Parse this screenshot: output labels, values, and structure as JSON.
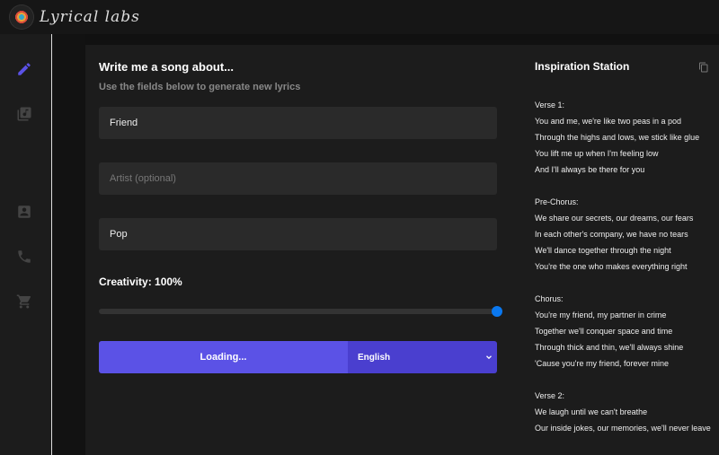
{
  "app": {
    "name": "Lyrical labs"
  },
  "sidebar": {
    "items": [
      {
        "icon": "pencil-icon",
        "active": true
      },
      {
        "icon": "music-library-icon"
      },
      {
        "icon": "contact-icon"
      },
      {
        "icon": "phone-icon"
      },
      {
        "icon": "cart-icon"
      }
    ],
    "accent": "#5b52e6"
  },
  "form": {
    "title": "Write me a song about...",
    "subtitle": "Use the fields below to generate new lyrics",
    "topic": {
      "value": "Friend"
    },
    "artist": {
      "placeholder": "Artist (optional)"
    },
    "genre": {
      "value": "Pop"
    },
    "creativity_label": "Creativity: 100%",
    "creativity": 100,
    "submit_label": "Loading...",
    "language": "English"
  },
  "inspiration": {
    "title": "Inspiration Station",
    "sections": [
      {
        "heading": "Verse 1:",
        "lines": [
          "You and me, we're like two peas in a pod",
          "Through the highs and lows, we stick like glue",
          "You lift me up when I'm feeling low",
          "And I'll always be there for you"
        ]
      },
      {
        "heading": "Pre-Chorus:",
        "lines": [
          "We share our secrets, our dreams, our fears",
          "In each other's company, we have no tears",
          "We'll dance together through the night",
          "You're the one who makes everything right"
        ]
      },
      {
        "heading": "Chorus:",
        "lines": [
          "You're my friend, my partner in crime",
          "Together we'll conquer space and time",
          "Through thick and thin, we'll always shine",
          "'Cause you're my friend, forever mine"
        ]
      },
      {
        "heading": "Verse 2:",
        "lines": [
          "We laugh until we can't breathe",
          "Our inside jokes, our memories, we'll never leave"
        ]
      }
    ]
  }
}
